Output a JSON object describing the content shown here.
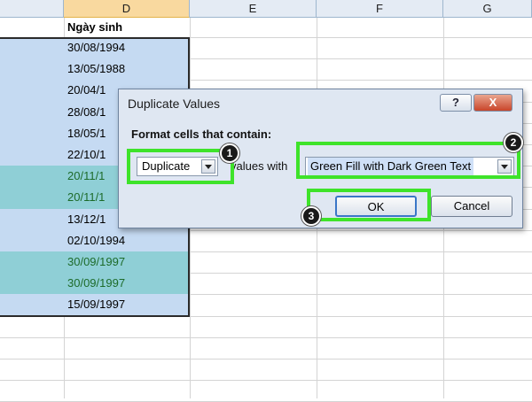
{
  "spreadsheet": {
    "columns": [
      "D",
      "E",
      "F",
      "G"
    ],
    "header_cell": "Ngày sinh",
    "rows": [
      {
        "value": "30/08/1994",
        "style": "blue"
      },
      {
        "value": "13/05/1988",
        "style": "blue"
      },
      {
        "value": "20/04/1",
        "style": "blue"
      },
      {
        "value": "28/08/1",
        "style": "blue"
      },
      {
        "value": "18/05/1",
        "style": "blue"
      },
      {
        "value": "22/10/1",
        "style": "blue"
      },
      {
        "value": "20/11/1",
        "style": "teal"
      },
      {
        "value": "20/11/1",
        "style": "teal"
      },
      {
        "value": "13/12/1",
        "style": "blue"
      },
      {
        "value": "02/10/1994",
        "style": "blue"
      },
      {
        "value": "30/09/1997",
        "style": "teal"
      },
      {
        "value": "30/09/1997",
        "style": "teal"
      },
      {
        "value": "15/09/1997",
        "style": "blue"
      }
    ]
  },
  "dialog": {
    "title": "Duplicate Values",
    "help_label": "?",
    "close_label": "X",
    "format_label": "Format cells that contain:",
    "type_value": "Duplicate",
    "values_with_label": "values with",
    "format_value": "Green Fill with Dark Green Text",
    "ok_label": "OK",
    "cancel_label": "Cancel"
  },
  "annotations": [
    "1",
    "2",
    "3"
  ],
  "colors": {
    "highlight": "#3ee32a",
    "cell_blue": "#c5daf2",
    "cell_teal": "#8fcfd6",
    "dark_green_text": "#1d6b2a"
  }
}
